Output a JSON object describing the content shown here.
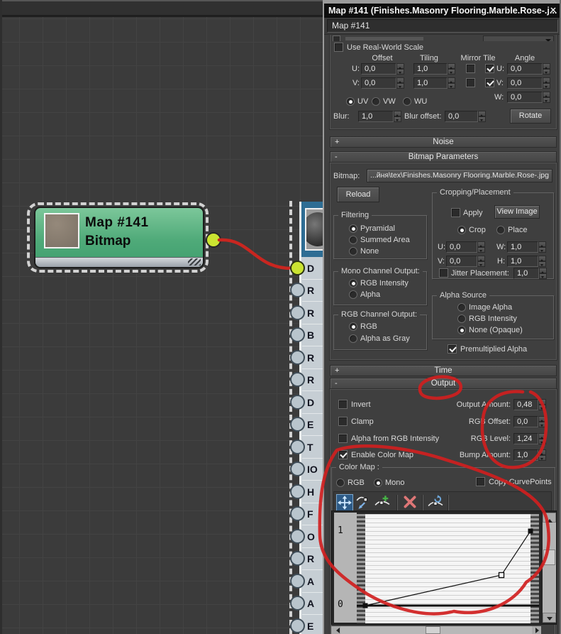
{
  "window": {
    "title": "Map #141 (Finishes.Masonry Flooring.Marble.Rose-.j...",
    "close_glyph": "✕"
  },
  "name_field": {
    "value": "Map #141"
  },
  "coordinates": {
    "use_real_world": {
      "label": "Use Real-World Scale",
      "checked": false
    },
    "col_headers": [
      "Offset",
      "Tiling",
      "Mirror Tile",
      "Angle"
    ],
    "rows": [
      {
        "label": "U:",
        "offset": "0,0",
        "tiling": "1,0",
        "mirror": false,
        "tile": true,
        "angle_label": "U:",
        "angle": "0,0"
      },
      {
        "label": "V:",
        "offset": "0,0",
        "tiling": "1,0",
        "mirror": false,
        "tile": true,
        "angle_label": "V:",
        "angle": "0,0"
      }
    ],
    "w_row": {
      "label": "W:",
      "value": "0,0"
    },
    "mapping": [
      {
        "label": "UV",
        "selected": true
      },
      {
        "label": "VW",
        "selected": false
      },
      {
        "label": "WU",
        "selected": false
      }
    ],
    "blur": {
      "label": "Blur:",
      "value": "1,0"
    },
    "blur_offset": {
      "label": "Blur offset:",
      "value": "0,0"
    },
    "rotate_button": "Rotate"
  },
  "rollouts": {
    "noise": {
      "label": "Noise",
      "state": "+"
    },
    "bitmap_parameters": {
      "label": "Bitmap Parameters",
      "state": "-"
    },
    "time": {
      "label": "Time",
      "state": "+"
    },
    "output": {
      "label": "Output",
      "state": "-"
    }
  },
  "bitmap_parameters": {
    "bitmap_label": "Bitmap:",
    "bitmap_path": "...йня\\tex\\Finishes.Masonry Flooring.Marble.Rose-.jpg",
    "reload_button": "Reload",
    "filtering": {
      "title": "Filtering",
      "options": [
        {
          "label": "Pyramidal",
          "selected": true
        },
        {
          "label": "Summed Area",
          "selected": false
        },
        {
          "label": "None",
          "selected": false
        }
      ]
    },
    "mono_channel": {
      "title": "Mono Channel Output:",
      "options": [
        {
          "label": "RGB Intensity",
          "selected": true
        },
        {
          "label": "Alpha",
          "selected": false
        }
      ]
    },
    "rgb_channel": {
      "title": "RGB Channel Output:",
      "options": [
        {
          "label": "RGB",
          "selected": true
        },
        {
          "label": "Alpha as Gray",
          "selected": false
        }
      ]
    },
    "cropping": {
      "title": "Cropping/Placement",
      "apply": {
        "label": "Apply",
        "checked": false
      },
      "view_image_button": "View Image",
      "mode": [
        {
          "label": "Crop",
          "selected": true
        },
        {
          "label": "Place",
          "selected": false
        }
      ],
      "u": {
        "label": "U:",
        "value": "0,0"
      },
      "v": {
        "label": "V:",
        "value": "0,0"
      },
      "w": {
        "label": "W:",
        "value": "1,0"
      },
      "h": {
        "label": "H:",
        "value": "1,0"
      },
      "jitter": {
        "label": "Jitter Placement:",
        "checked": false,
        "value": "1,0"
      }
    },
    "alpha_source": {
      "title": "Alpha Source",
      "options": [
        {
          "label": "Image Alpha",
          "selected": false
        },
        {
          "label": "RGB Intensity",
          "selected": false
        },
        {
          "label": "None (Opaque)",
          "selected": true
        }
      ]
    },
    "premultiplied": {
      "label": "Premultiplied Alpha",
      "checked": true
    }
  },
  "output": {
    "checkboxes": [
      {
        "label": "Invert",
        "checked": false
      },
      {
        "label": "Clamp",
        "checked": false
      },
      {
        "label": "Alpha from RGB Intensity",
        "checked": false
      },
      {
        "label": "Enable Color Map",
        "checked": true
      }
    ],
    "spinners": [
      {
        "label": "Output Amount:",
        "value": "0,48"
      },
      {
        "label": "RGB Offset:",
        "value": "0,0"
      },
      {
        "label": "RGB Level:",
        "value": "1,24"
      },
      {
        "label": "Bump Amount:",
        "value": "1,0"
      }
    ]
  },
  "color_map": {
    "title": "Color Map :",
    "mode": [
      {
        "label": "RGB",
        "selected": false
      },
      {
        "label": "Mono",
        "selected": true
      }
    ],
    "copy_curvepoints": {
      "label": "Copy CurvePoints",
      "checked": false
    },
    "toolbar_icons": [
      "move-point",
      "scale-point",
      "add-point",
      "delete-point",
      "reset-curve"
    ],
    "axis": {
      "top": "1",
      "bottom": "0"
    },
    "curve_points": [
      {
        "x": 0.0,
        "y": 0.0,
        "style": "corner"
      },
      {
        "x": 0.79,
        "y": 0.28,
        "style": "bezier"
      },
      {
        "x": 0.95,
        "y": 1.0,
        "style": "corner"
      }
    ]
  },
  "nodes": {
    "bitmap_node": {
      "title": "Map #141",
      "subtitle": "Bitmap"
    },
    "material_node": {
      "sockets": [
        "D",
        "R",
        "R",
        "B",
        "R",
        "R",
        "D",
        "E",
        "T",
        "IO",
        "H",
        "F",
        "O",
        "R",
        "A",
        "A",
        "E"
      ]
    }
  },
  "colors": {
    "node_green": "#4faa79",
    "socket_connected": "#cbe431",
    "wire_red": "#c92620",
    "annotation_red": "#d01f1f",
    "panel_bg": "#3f3f3f",
    "selection_blue": "#2d5a86"
  }
}
